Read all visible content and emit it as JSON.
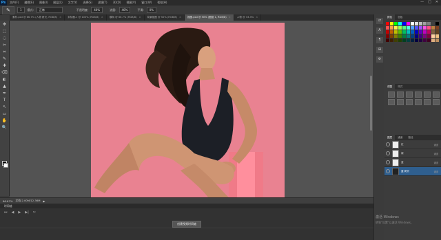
{
  "app": {
    "logo": "Ps",
    "menu": [
      "文件(F)",
      "编辑(E)",
      "图像(I)",
      "图层(L)",
      "文字(Y)",
      "选择(S)",
      "滤镜(T)",
      "3D(D)",
      "视图(V)",
      "窗口(W)",
      "帮助(H)"
    ],
    "window_buttons": [
      "—",
      "□",
      "✕"
    ]
  },
  "options": {
    "tool_icon": "brush-icon",
    "size": "1",
    "mode_label": "模式:",
    "mode": "正常",
    "opacity_label": "不透明度:",
    "opacity": "40%",
    "flow_label": "流量:",
    "flow": "40%",
    "smooth_label": "平滑:",
    "smooth": "0%"
  },
  "tabs": [
    {
      "label": "素材.psd @ 66.7% (人物 拷贝, RGB/8)",
      "active": false
    },
    {
      "label": "未标题-1 @ 100% (RGB/8)",
      "active": false
    },
    {
      "label": "模特 @ 66.7% (RGB/8)",
      "active": false
    },
    {
      "label": "背景抠图 @ 50% (RGB/8)",
      "active": false
    },
    {
      "label": "抠图.psd @ 50% (图层 1, RGB/8)",
      "active": true
    },
    {
      "label": "人物 @ 33.3%",
      "active": false
    }
  ],
  "tools": [
    "✥",
    "⬚",
    "◌",
    "✂",
    "⌗",
    "✎",
    "✚",
    "⌫",
    "◐",
    "▲",
    "✒",
    "T",
    "↖",
    "▭",
    "✋",
    "🔍"
  ],
  "status": {
    "zoom": "66.67%",
    "doc": "文档:2.00M/12.36M",
    "arrow": "▶"
  },
  "timeline": {
    "title": "时间轴",
    "controls": [
      "⏮",
      "◀",
      "▶",
      "▶|",
      "✂"
    ],
    "create_button": "创建视频时间轴"
  },
  "side_icons": [
    "⇄",
    "A",
    "¶",
    "⊞",
    "⚙"
  ],
  "panels": {
    "color_tabs": [
      "颜色",
      "色板"
    ],
    "swatch_colors": [
      "#ff0000",
      "#ffff00",
      "#00ff00",
      "#00ffff",
      "#0000ff",
      "#ff00ff",
      "#ffffff",
      "#e0e0e0",
      "#c0c0c0",
      "#a0a0a0",
      "#808080",
      "#404040",
      "#000000",
      "#ff5050",
      "#ffa050",
      "#fff050",
      "#a0ff50",
      "#50ff80",
      "#50ffe0",
      "#50a0ff",
      "#5050ff",
      "#a050ff",
      "#ff50e0",
      "#ff5080",
      "#c08040",
      "#804020",
      "#c00000",
      "#c06000",
      "#c0c000",
      "#60c000",
      "#00c060",
      "#00c0c0",
      "#0060c0",
      "#0000c0",
      "#6000c0",
      "#c000c0",
      "#c00060",
      "#806040",
      "#604020",
      "#800000",
      "#804000",
      "#808000",
      "#408000",
      "#008040",
      "#008080",
      "#004080",
      "#000080",
      "#400080",
      "#800080",
      "#800040",
      "#ffd0a0",
      "#f0c080",
      "#400000",
      "#402000",
      "#404000",
      "#204000",
      "#004020",
      "#004040",
      "#002040",
      "#000040",
      "#200040",
      "#400040",
      "#400020",
      "#e0b080",
      "#c09060"
    ],
    "adjust_tabs": [
      "调整",
      "样式"
    ],
    "layer_tabs": [
      "图层",
      "通道",
      "路径"
    ],
    "layers": [
      {
        "name": "红",
        "kind": "通道",
        "dark": false,
        "selected": false
      },
      {
        "name": "绿",
        "kind": "通道",
        "dark": false,
        "selected": false
      },
      {
        "name": "蓝",
        "kind": "通道",
        "dark": false,
        "selected": false
      },
      {
        "name": "蓝 拷贝",
        "kind": "通道",
        "dark": true,
        "selected": true
      }
    ]
  },
  "watermark": {
    "line1": "激活 Windows",
    "line2": "转到\"设置\"以激活 Windows。"
  }
}
